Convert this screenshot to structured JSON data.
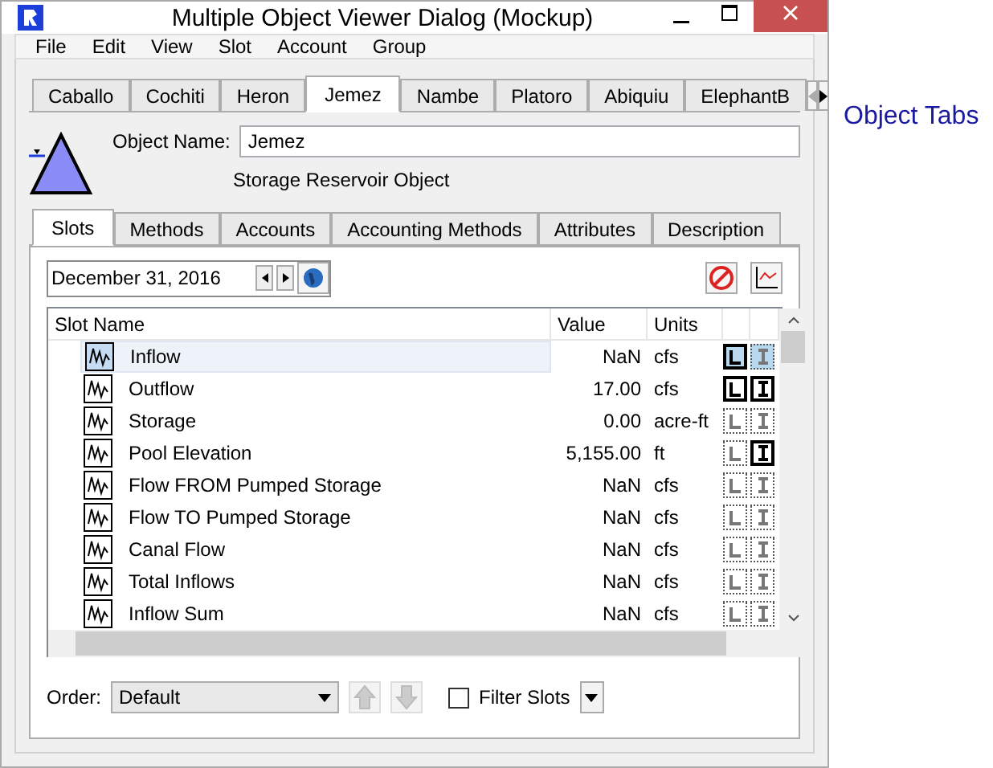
{
  "window": {
    "title": "Multiple Object Viewer Dialog (Mockup)"
  },
  "menu": [
    "File",
    "Edit",
    "View",
    "Slot",
    "Account",
    "Group"
  ],
  "object_tabs": [
    {
      "label": "Caballo",
      "selected": false
    },
    {
      "label": "Cochiti",
      "selected": false
    },
    {
      "label": "Heron",
      "selected": false
    },
    {
      "label": "Jemez",
      "selected": true
    },
    {
      "label": "Nambe",
      "selected": false
    },
    {
      "label": "Platoro",
      "selected": false
    },
    {
      "label": "Abiquiu",
      "selected": false
    },
    {
      "label": "ElephantB",
      "selected": false
    }
  ],
  "object": {
    "name_label": "Object Name:",
    "name": "Jemez",
    "type": "Storage Reservoir Object"
  },
  "tabs": [
    {
      "label": "Slots",
      "selected": true
    },
    {
      "label": "Methods",
      "selected": false
    },
    {
      "label": "Accounts",
      "selected": false
    },
    {
      "label": "Accounting Methods",
      "selected": false
    },
    {
      "label": "Attributes",
      "selected": false
    },
    {
      "label": "Description",
      "selected": false
    }
  ],
  "date": "December 31, 2016",
  "table": {
    "columns": [
      "Slot Name",
      "Value",
      "Units"
    ],
    "rows": [
      {
        "name": "Inflow",
        "value": "NaN",
        "units": "cfs",
        "selected": true,
        "l_set": true,
        "i_set": false
      },
      {
        "name": "Outflow",
        "value": "17.00",
        "units": "cfs",
        "selected": false,
        "l_set": true,
        "i_set": true
      },
      {
        "name": "Storage",
        "value": "0.00",
        "units": "acre-ft",
        "selected": false,
        "l_set": false,
        "i_set": false
      },
      {
        "name": "Pool Elevation",
        "value": "5,155.00",
        "units": "ft",
        "selected": false,
        "l_set": false,
        "i_set": true
      },
      {
        "name": "Flow FROM Pumped Storage",
        "value": "NaN",
        "units": "cfs",
        "selected": false,
        "l_set": false,
        "i_set": false
      },
      {
        "name": "Flow TO Pumped Storage",
        "value": "NaN",
        "units": "cfs",
        "selected": false,
        "l_set": false,
        "i_set": false
      },
      {
        "name": "Canal Flow",
        "value": "NaN",
        "units": "cfs",
        "selected": false,
        "l_set": false,
        "i_set": false
      },
      {
        "name": "Total Inflows",
        "value": "NaN",
        "units": "cfs",
        "selected": false,
        "l_set": false,
        "i_set": false
      },
      {
        "name": "Inflow Sum",
        "value": "NaN",
        "units": "cfs",
        "selected": false,
        "l_set": false,
        "i_set": false
      }
    ]
  },
  "order": {
    "label": "Order:",
    "value": "Default"
  },
  "filter": {
    "label": "Filter Slots",
    "checked": false
  },
  "annotation": "Object Tabs"
}
